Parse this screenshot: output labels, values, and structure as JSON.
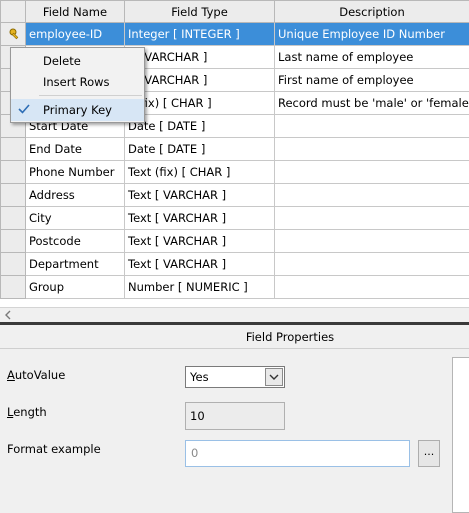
{
  "table": {
    "headers": [
      "Field Name",
      "Field Type",
      "Description"
    ],
    "rows": [
      {
        "name": "employee-ID",
        "type": "Integer [ INTEGER ]",
        "desc": "Unique Employee ID Number"
      },
      {
        "name": "",
        "type": "t [ VARCHAR ]",
        "desc": "Last name of employee"
      },
      {
        "name": "",
        "type": "t [ VARCHAR ]",
        "desc": "First name of employee"
      },
      {
        "name": "",
        "type": "t (fix) [ CHAR ]",
        "desc": "Record must be 'male' or 'female'"
      },
      {
        "name": "Start Date",
        "type": "Date [ DATE ]",
        "desc": ""
      },
      {
        "name": "End Date",
        "type": "Date [ DATE ]",
        "desc": ""
      },
      {
        "name": "Phone Number",
        "type": "Text (fix) [ CHAR ]",
        "desc": ""
      },
      {
        "name": "Address",
        "type": "Text [ VARCHAR ]",
        "desc": ""
      },
      {
        "name": "City",
        "type": "Text [ VARCHAR ]",
        "desc": ""
      },
      {
        "name": "Postcode",
        "type": "Text [ VARCHAR ]",
        "desc": ""
      },
      {
        "name": "Department",
        "type": "Text [ VARCHAR ]",
        "desc": ""
      },
      {
        "name": "Group",
        "type": "Number [ NUMERIC ]",
        "desc": ""
      }
    ]
  },
  "context_menu": {
    "items": [
      {
        "label": "Delete",
        "checked": false
      },
      {
        "label": "Insert Rows",
        "checked": false
      },
      {
        "label": "Primary Key",
        "checked": true
      }
    ]
  },
  "properties": {
    "title": "Field Properties",
    "autovalue_label_first": "A",
    "autovalue_label_rest": "utoValue",
    "autovalue_value": "Yes",
    "length_label_first": "L",
    "length_label_rest": "ength",
    "length_value": "10",
    "format_label": "Format example",
    "format_value": "0",
    "ellipsis": "..."
  },
  "icons": {
    "primary_key": "key-icon",
    "dropdown": "chevron-down-icon",
    "scroll_left": "chevron-left-icon",
    "check": "check-icon"
  },
  "colors": {
    "selection": "#3c8ed9",
    "menu_checked": "#d7e6f5"
  }
}
